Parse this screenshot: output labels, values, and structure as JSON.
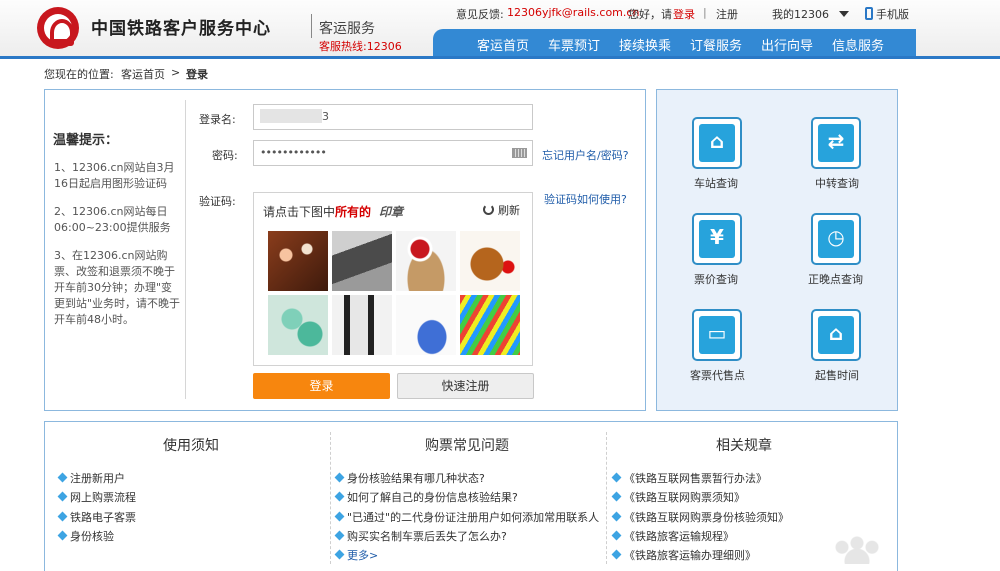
{
  "header": {
    "brand": "中国铁路客户服务中心",
    "subtitle": "客运服务",
    "hotline": "客服热线:12306",
    "feedback_label": "意见反馈:",
    "feedback_email": "12306yjfk@rails.com.cn",
    "greeting": "您好，请",
    "login_link": "登录",
    "divider": "|",
    "register_link": "注册",
    "my12306": "我的12306",
    "mobile": "手机版",
    "colors": {
      "nav": "#3389d4",
      "accent": "#f7860e",
      "red": "#d40000"
    }
  },
  "nav": [
    "客运首页",
    "车票预订",
    "接续换乘",
    "订餐服务",
    "出行向导",
    "信息服务"
  ],
  "breadcrumb": {
    "prefix": "您现在的位置:",
    "home": "客运首页",
    "sep": ">",
    "current": "登录"
  },
  "tips": {
    "title": "温馨提示：",
    "items": [
      "1、12306.cn网站自3月16日起启用图形验证码",
      "2、12306.cn网站每日06:00~23:00提供服务",
      "3、在12306.cn网站购票、改签和退票须不晚于开车前30分钟；办理\"变更到站\"业务时，请不晚于开车前48小时。"
    ]
  },
  "form": {
    "username_label": "登录名:",
    "username_value": "3",
    "password_label": "密码:",
    "password_value": "••••••••••••",
    "forgot_link": "忘记用户名/密码?",
    "captcha_label": "验证码:",
    "captcha_help": "验证码如何使用?",
    "captcha_prompt": "请点击下图中",
    "captcha_emph": "所有的",
    "captcha_target": "印章",
    "refresh": "刷新",
    "login_button": "登录",
    "quick_register": "快速注册"
  },
  "services": [
    "车站查询",
    "中转查询",
    "票价查询",
    "正晚点查询",
    "客票代售点",
    "起售时间"
  ],
  "bottom": {
    "columns": [
      {
        "title": "使用须知",
        "items": [
          "注册新用户",
          "网上购票流程",
          "铁路电子客票",
          "身份核验"
        ]
      },
      {
        "title": "购票常见问题",
        "items": [
          "身份核验结果有哪几种状态?",
          "如何了解自己的身份信息核验结果?",
          "\"已通过\"的二代身份证注册用户如何添加常用联系人",
          "购买实名制车票后丢失了怎么办?"
        ],
        "more": "更多>"
      },
      {
        "title": "相关规章",
        "items": [
          "《铁路互联网售票暂行办法》",
          "《铁路互联网购票须知》",
          "《铁路互联网购票身份核验须知》",
          "《铁路旅客运输规程》",
          "《铁路旅客运输办理细则》"
        ]
      }
    ]
  }
}
